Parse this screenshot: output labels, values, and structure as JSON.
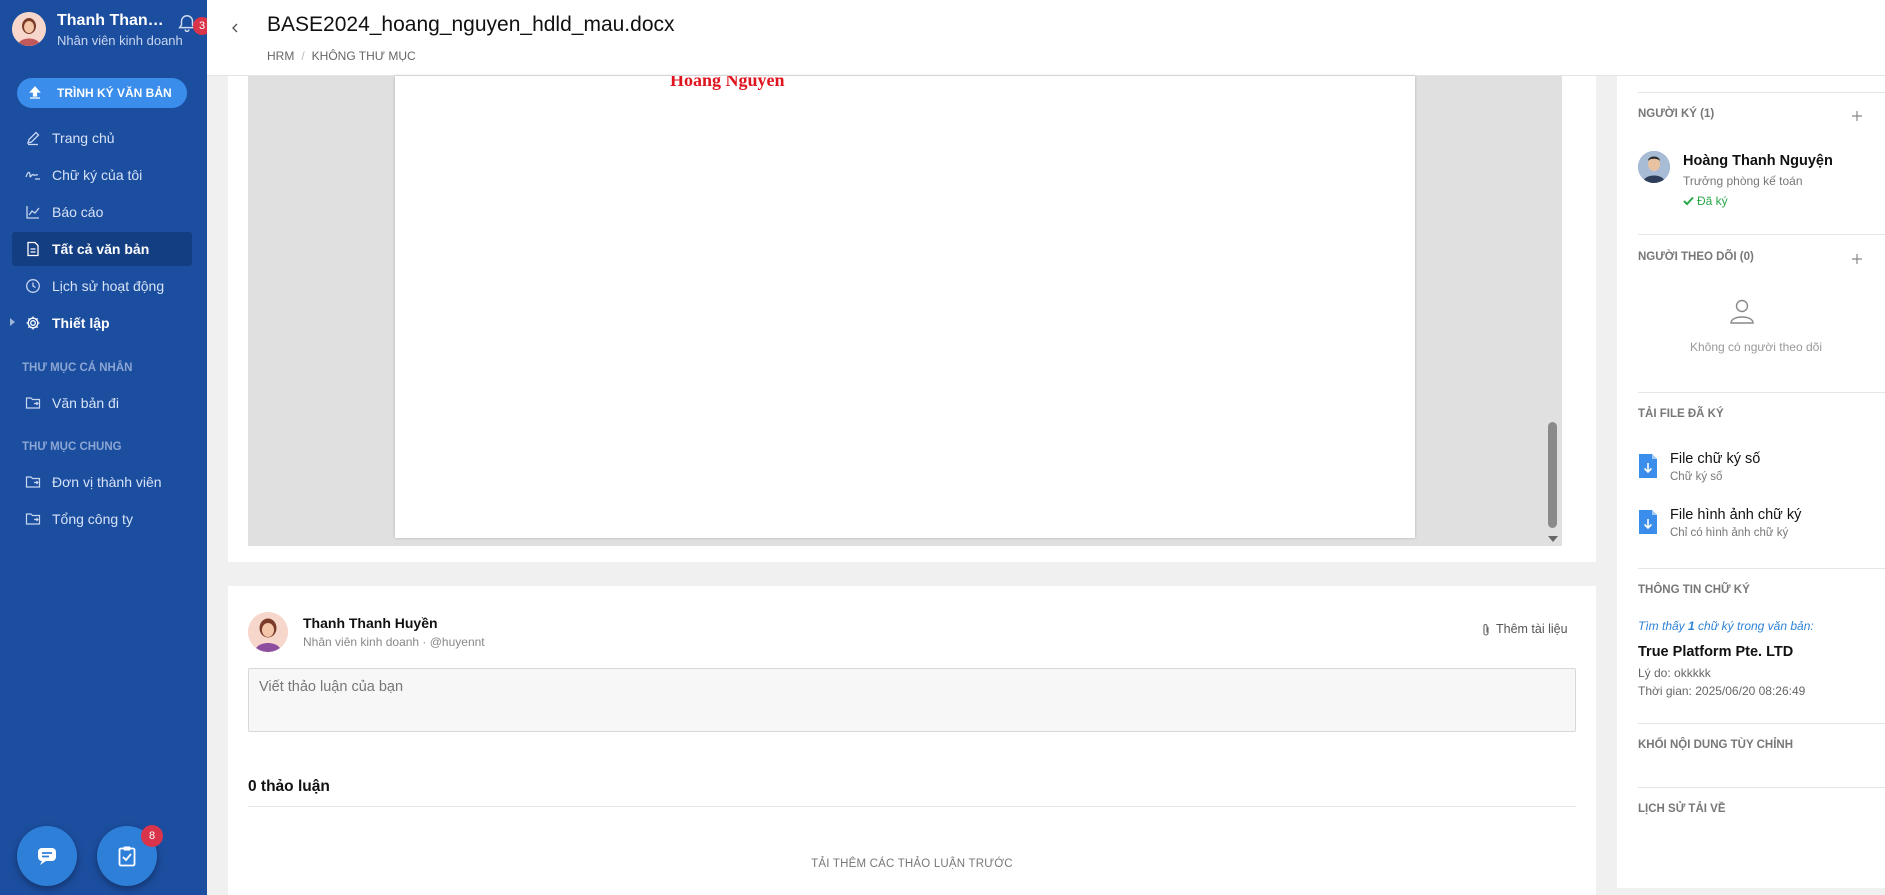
{
  "user": {
    "name": "Thanh Thanh Huyền",
    "role": "Nhân viên kinh doanh",
    "notification_count": "3"
  },
  "sidebar": {
    "sign_button": "TRÌNH KÝ VĂN BẢN",
    "items": [
      {
        "label": "Trang chủ",
        "icon": "pencil-icon"
      },
      {
        "label": "Chữ ký của tôi",
        "icon": "signature-icon"
      },
      {
        "label": "Báo cáo",
        "icon": "chart-icon"
      },
      {
        "label": "Tất cả văn bản",
        "icon": "document-icon",
        "active": true
      },
      {
        "label": "Lịch sử hoạt động",
        "icon": "clock-icon"
      },
      {
        "label": "Thiết lập",
        "icon": "gear-icon"
      }
    ],
    "personal_folder_label": "THƯ MỤC CÁ NHÂN",
    "personal_items": [
      {
        "label": "Văn bản đi",
        "icon": "folder-icon"
      }
    ],
    "shared_folder_label": "THƯ MỤC CHUNG",
    "shared_items": [
      {
        "label": "Đơn vị thành viên",
        "icon": "folder-icon"
      },
      {
        "label": "Tổng công ty",
        "icon": "folder-icon"
      }
    ],
    "task_badge": "8"
  },
  "header": {
    "title": "BASE2024_hoang_nguyen_hdld_mau.docx",
    "breadcrumb": [
      "HRM",
      "KHÔNG THƯ MỤC"
    ]
  },
  "viewer": {
    "signature_text": "Hoàng Nguyên"
  },
  "discussion": {
    "author_name": "Thanh Thanh Huyền",
    "author_sub": "Nhân viên kinh doanh · @huyennt",
    "attach_label": "Thêm tài liệu",
    "placeholder": "Viết thảo luận của bạn",
    "count_label": "0 thảo luận",
    "load_more": "TẢI THÊM CÁC THẢO LUẬN TRƯỚC"
  },
  "panel": {
    "signers_title": "NGƯỜI KÝ (1)",
    "signer": {
      "name": "Hoàng Thanh Nguyện",
      "role": "Trưởng phòng kế toán",
      "status": "Đã ký"
    },
    "followers_title": "NGƯỜI THEO DÕI (0)",
    "no_followers": "Không có người theo dõi",
    "download_title": "TẢI FILE ĐÃ KÝ",
    "files": [
      {
        "title": "File chữ ký số",
        "sub": "Chữ ký số"
      },
      {
        "title": "File hình ảnh chữ ký",
        "sub": "Chỉ có hình ảnh chữ ký"
      }
    ],
    "sig_info_title": "THÔNG TIN CHỮ KÝ",
    "sig_info_lead_prefix": "Tìm thấy ",
    "sig_info_count": "1",
    "sig_info_lead_suffix": " chữ ký trong văn bản:",
    "org": "True Platform Pte. LTD",
    "reason": "Lý do: okkkkk",
    "time": "Thời gian: 2025/06/20 08:26:49",
    "custom_block_title": "KHỐI NỘI DUNG TÙY CHỈNH",
    "download_history_title": "LỊCH SỬ TẢI VỀ"
  },
  "colors": {
    "sidebar": "#1c4ea0",
    "accent": "#3a8dea",
    "badge": "#d9344a",
    "success": "#2aa84a",
    "signature": "#e0141e"
  }
}
